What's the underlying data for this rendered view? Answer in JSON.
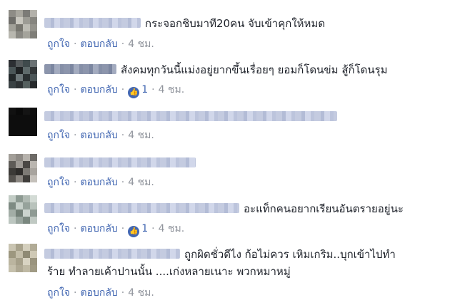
{
  "colors": {
    "link": "#4267b2",
    "meta": "#90949c",
    "text": "#1d2129"
  },
  "comments": [
    {
      "text": "กระจอกชิบมาที20คน จับเข้าคุกให้หมด",
      "like": "ถูกใจ",
      "reply": "ตอบกลับ",
      "likes": "",
      "time": "4 ชม."
    },
    {
      "text": "สังคมทุกวันนี้แม่งอยู่ยากขึ้นเรื่อยๆ ยอมก็โดนข่ม สู้ก็โดนรุม",
      "like": "ถูกใจ",
      "reply": "ตอบกลับ",
      "likes": "1",
      "time": "4 ชม."
    },
    {
      "text": "",
      "like": "ถูกใจ",
      "reply": "ตอบกลับ",
      "likes": "",
      "time": "4 ชม."
    },
    {
      "text": "",
      "like": "ถูกใจ",
      "reply": "ตอบกลับ",
      "likes": "",
      "time": "4 ชม."
    },
    {
      "text": "อะแท็กคนอยากเรียนอันตรายอยู่นะ",
      "like": "ถูกใจ",
      "reply": "ตอบกลับ",
      "likes": "1",
      "time": "4 ชม."
    },
    {
      "text": "ถูกผิดชั่วดีไง ก้อไม่ควร เหิมเกริม..บุกเข้าไปทำ",
      "text2": "ร้าย ทำลายเค้าปานนั้น ....เก่งหลายเนาะ พวกหมาหมู่",
      "like": "ถูกใจ",
      "reply": "ตอบกลับ",
      "likes": "",
      "time": "4 ชม."
    }
  ]
}
